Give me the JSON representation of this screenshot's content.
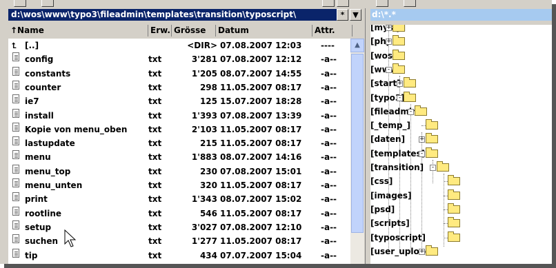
{
  "left_panel": {
    "path": "d:\\wos\\www\\typo3\\fileadmin\\templates\\transition\\typoscript\\",
    "star_button": "*",
    "dropdown_button": "▼",
    "columns": {
      "name": "↑Name",
      "ext": "Erw.",
      "size": "Grösse",
      "date": "Datum",
      "attr": "Attr."
    },
    "rows": [
      {
        "name": "[..]",
        "ext": "",
        "size": "<DIR>",
        "date": "07.08.2007 12:03",
        "attr": "----",
        "type": "up"
      },
      {
        "name": "config",
        "ext": "txt",
        "size": "3'281",
        "date": "07.08.2007 12:12",
        "attr": "-a--",
        "type": "file"
      },
      {
        "name": "constants",
        "ext": "txt",
        "size": "1'205",
        "date": "08.07.2007 14:55",
        "attr": "-a--",
        "type": "file"
      },
      {
        "name": "counter",
        "ext": "txt",
        "size": "298",
        "date": "11.05.2007 08:17",
        "attr": "-a--",
        "type": "file"
      },
      {
        "name": "ie7",
        "ext": "txt",
        "size": "125",
        "date": "15.07.2007 18:28",
        "attr": "-a--",
        "type": "file"
      },
      {
        "name": "install",
        "ext": "txt",
        "size": "1'393",
        "date": "07.08.2007 13:39",
        "attr": "-a--",
        "type": "file"
      },
      {
        "name": "Kopie von menu_oben",
        "ext": "txt",
        "size": "2'103",
        "date": "11.05.2007 08:17",
        "attr": "-a--",
        "type": "file"
      },
      {
        "name": "lastupdate",
        "ext": "txt",
        "size": "215",
        "date": "11.05.2007 08:17",
        "attr": "-a--",
        "type": "file"
      },
      {
        "name": "menu",
        "ext": "txt",
        "size": "1'883",
        "date": "08.07.2007 14:16",
        "attr": "-a--",
        "type": "file"
      },
      {
        "name": "menu_top",
        "ext": "txt",
        "size": "230",
        "date": "07.08.2007 15:01",
        "attr": "-a--",
        "type": "file"
      },
      {
        "name": "menu_unten",
        "ext": "txt",
        "size": "320",
        "date": "11.05.2007 08:17",
        "attr": "-a--",
        "type": "file"
      },
      {
        "name": "print",
        "ext": "txt",
        "size": "1'343",
        "date": "08.07.2007 15:02",
        "attr": "-a--",
        "type": "file"
      },
      {
        "name": "rootline",
        "ext": "txt",
        "size": "546",
        "date": "11.05.2007 08:17",
        "attr": "-a--",
        "type": "file"
      },
      {
        "name": "setup",
        "ext": "txt",
        "size": "3'027",
        "date": "07.08.2007 12:10",
        "attr": "-a--",
        "type": "file"
      },
      {
        "name": "suchen",
        "ext": "txt",
        "size": "1'277",
        "date": "11.05.2007 08:17",
        "attr": "-a--",
        "type": "file"
      },
      {
        "name": "tip",
        "ext": "txt",
        "size": "434",
        "date": "07.07.2007 15:04",
        "attr": "-a--",
        "type": "file"
      }
    ]
  },
  "right_panel": {
    "path": "d:\\*.*",
    "tree": [
      {
        "label": "[mysql]",
        "level": 0,
        "expander": "+"
      },
      {
        "label": "[php5]",
        "level": 0,
        "expander": "+"
      },
      {
        "label": "[wos]",
        "level": 0,
        "expander": ""
      },
      {
        "label": "[www]",
        "level": 0,
        "expander": "-"
      },
      {
        "label": "[start]",
        "level": 1,
        "expander": "+"
      },
      {
        "label": "[typo3]",
        "level": 1,
        "expander": "-"
      },
      {
        "label": "[fileadmin]",
        "level": 2,
        "expander": "-"
      },
      {
        "label": "[_temp_]",
        "level": 3,
        "expander": ""
      },
      {
        "label": "[daten]",
        "level": 3,
        "expander": "+"
      },
      {
        "label": "[templates]",
        "level": 3,
        "expander": "-"
      },
      {
        "label": "[transition]",
        "level": 4,
        "expander": "-"
      },
      {
        "label": "[css]",
        "level": 5,
        "expander": ""
      },
      {
        "label": "[images]",
        "level": 5,
        "expander": ""
      },
      {
        "label": "[psd]",
        "level": 5,
        "expander": ""
      },
      {
        "label": "[scripts]",
        "level": 5,
        "expander": ""
      },
      {
        "label": "[typoscript]",
        "level": 5,
        "expander": "",
        "open": true
      },
      {
        "label": "[user_upload]",
        "level": 3,
        "expander": "+"
      }
    ]
  },
  "colors": {
    "path_active": "#0a246a",
    "path_inactive": "#a6caf0",
    "folder": "#ffea80",
    "chrome": "#d4d0c8"
  }
}
